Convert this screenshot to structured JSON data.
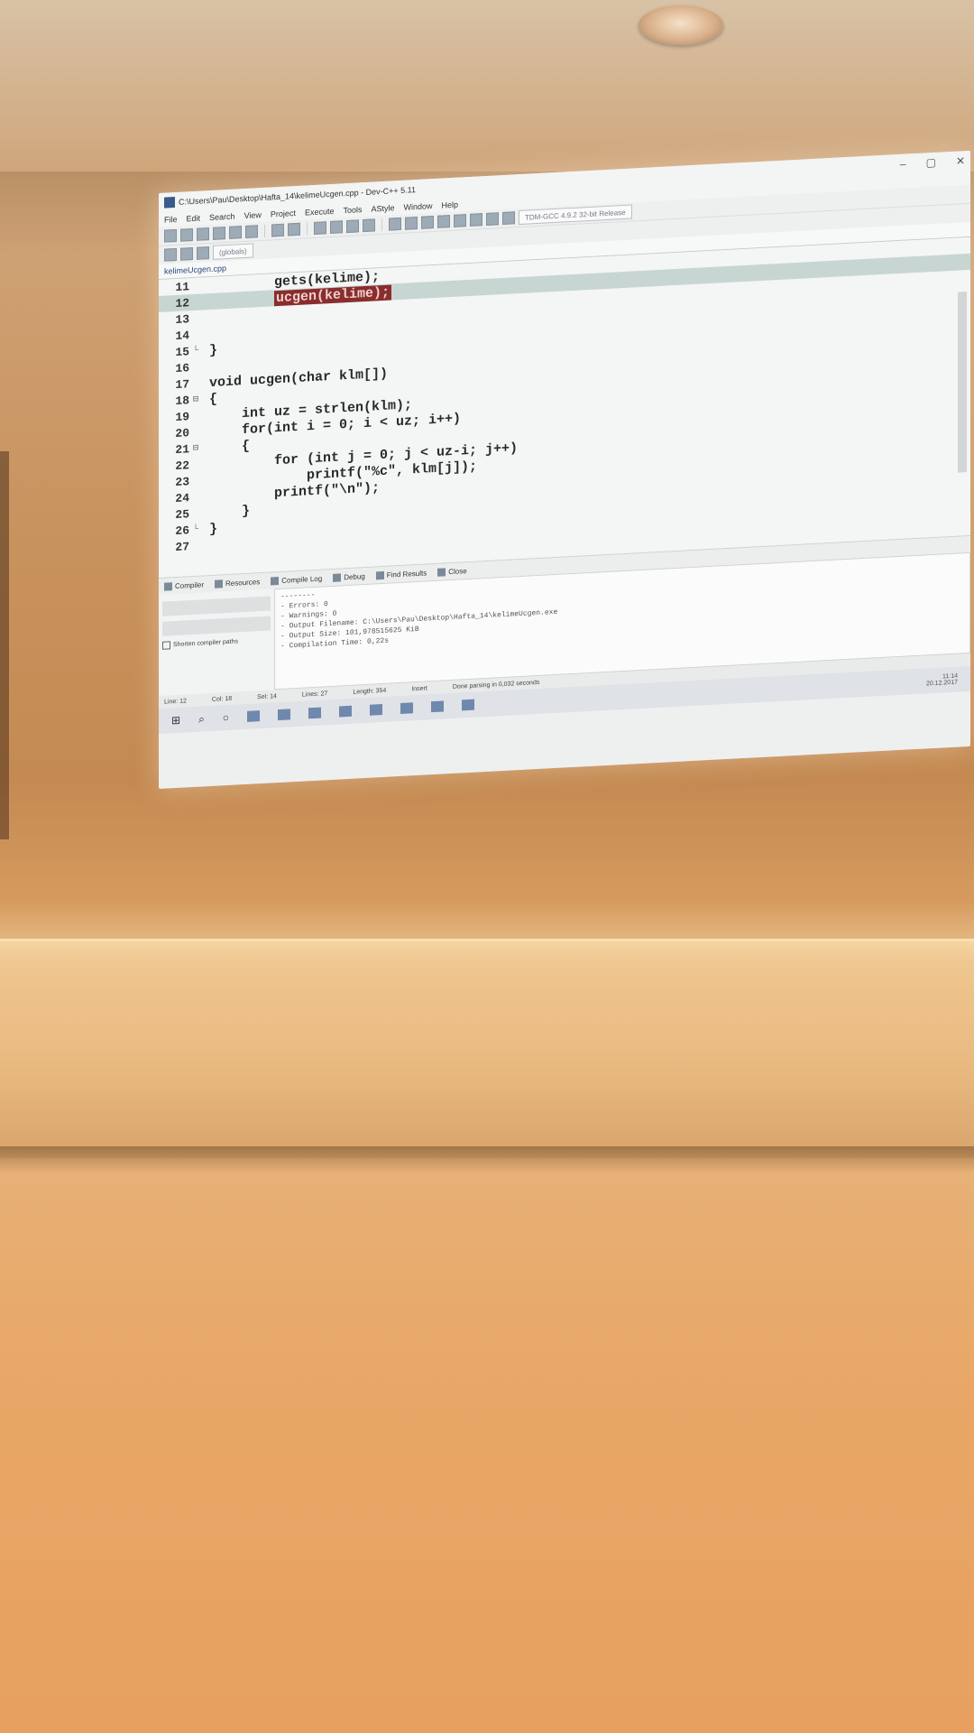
{
  "window": {
    "title": "C:\\Users\\Pau\\Desktop\\Hafta_14\\kelimeUcgen.cpp - Dev-C++ 5.11",
    "minimize": "–",
    "maximize": "▢",
    "close": "✕"
  },
  "menu": [
    "File",
    "Edit",
    "Search",
    "View",
    "Project",
    "Execute",
    "Tools",
    "AStyle",
    "Window",
    "Help"
  ],
  "toolbar": {
    "compiler_select": "TDM-GCC 4.9.2 32-bit Release",
    "globals_select": "(globals)"
  },
  "file_tab": "kelimeUcgen.cpp",
  "editor": {
    "lines": [
      {
        "num": "11",
        "fold": "",
        "code": "        gets(kelime);",
        "selected": ""
      },
      {
        "num": "12",
        "fold": "",
        "code": "        ",
        "selected": "ucgen(kelime);"
      },
      {
        "num": "13",
        "fold": "",
        "code": "",
        "selected": ""
      },
      {
        "num": "14",
        "fold": "",
        "code": "",
        "selected": ""
      },
      {
        "num": "15",
        "fold": "└",
        "code": "}",
        "selected": ""
      },
      {
        "num": "16",
        "fold": "",
        "code": "",
        "selected": ""
      },
      {
        "num": "17",
        "fold": "",
        "code": "void ucgen(char klm[])",
        "selected": ""
      },
      {
        "num": "18",
        "fold": "⊟",
        "code": "{",
        "selected": ""
      },
      {
        "num": "19",
        "fold": "",
        "code": "    int uz = strlen(klm);",
        "selected": ""
      },
      {
        "num": "20",
        "fold": "",
        "code": "    for(int i = 0; i < uz; i++)",
        "selected": ""
      },
      {
        "num": "21",
        "fold": "⊟",
        "code": "    {",
        "selected": ""
      },
      {
        "num": "22",
        "fold": "",
        "code": "        for (int j = 0; j < uz-i; j++)",
        "selected": ""
      },
      {
        "num": "23",
        "fold": "",
        "code": "            printf(\"%c\", klm[j]);",
        "selected": ""
      },
      {
        "num": "24",
        "fold": "",
        "code": "        printf(\"\\n\");",
        "selected": ""
      },
      {
        "num": "25",
        "fold": "",
        "code": "    }",
        "selected": ""
      },
      {
        "num": "26",
        "fold": "└",
        "code": "}",
        "selected": ""
      },
      {
        "num": "27",
        "fold": "",
        "code": "",
        "selected": ""
      }
    ]
  },
  "bottom_tabs": [
    "Compiler",
    "Resources",
    "Compile Log",
    "Debug",
    "Find Results",
    "Close"
  ],
  "bottom_left": {
    "shorten_label": "Shorten compiler paths"
  },
  "compile_log": [
    "--------",
    "- Errors: 0",
    "- Warnings: 0",
    "- Output Filename: C:\\Users\\Pau\\Desktop\\Hafta_14\\kelimeUcgen.exe",
    "- Output Size: 101,978515625 KiB",
    "- Compilation Time: 0,22s"
  ],
  "status": {
    "line": "Line:   12",
    "col": "Col:   18",
    "sel": "Sel:   14",
    "lines": "Lines:   27",
    "length": "Length:   354",
    "mode": "Insert",
    "message": "Done parsing in 0,032 seconds"
  },
  "taskbar": {
    "time": "11:14",
    "date": "20.12.2017"
  }
}
